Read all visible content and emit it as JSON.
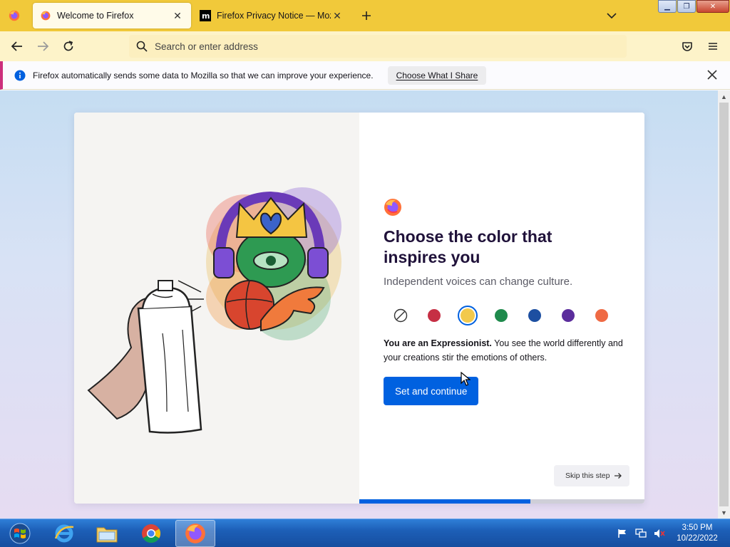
{
  "tabs": [
    {
      "title": "Welcome to Firefox",
      "active": true
    },
    {
      "title": "Firefox Privacy Notice — Mozilla",
      "active": false
    }
  ],
  "address_bar": {
    "placeholder": "Search or enter address"
  },
  "notification": {
    "text": "Firefox automatically sends some data to Mozilla so that we can improve your experience.",
    "button": "Choose What I Share"
  },
  "onboarding": {
    "heading": "Choose the color that inspires you",
    "subheading": "Independent voices can change culture.",
    "swatches": [
      {
        "name": "none",
        "color": "#ffffff",
        "selected": false
      },
      {
        "name": "red",
        "color": "#c62f44",
        "selected": false
      },
      {
        "name": "yellow",
        "color": "#f2c94c",
        "selected": true
      },
      {
        "name": "green",
        "color": "#1f8a4c",
        "selected": false
      },
      {
        "name": "blue",
        "color": "#1d4fa1",
        "selected": false
      },
      {
        "name": "purple",
        "color": "#5b2d9c",
        "selected": false
      },
      {
        "name": "orange",
        "color": "#ef6a44",
        "selected": false
      }
    ],
    "description_bold": "You are an Expressionist.",
    "description_rest": " You see the world differently and your creations stir the emotions of others.",
    "primary_button": "Set and continue",
    "skip_button": "Skip this step",
    "progress": 0.6
  },
  "taskbar": {
    "time": "3:50 PM",
    "date": "10/22/2022"
  },
  "colors": {
    "tabstrip": "#f1c93a",
    "navbar": "#fdf3c9",
    "accent": "#0061e0"
  }
}
